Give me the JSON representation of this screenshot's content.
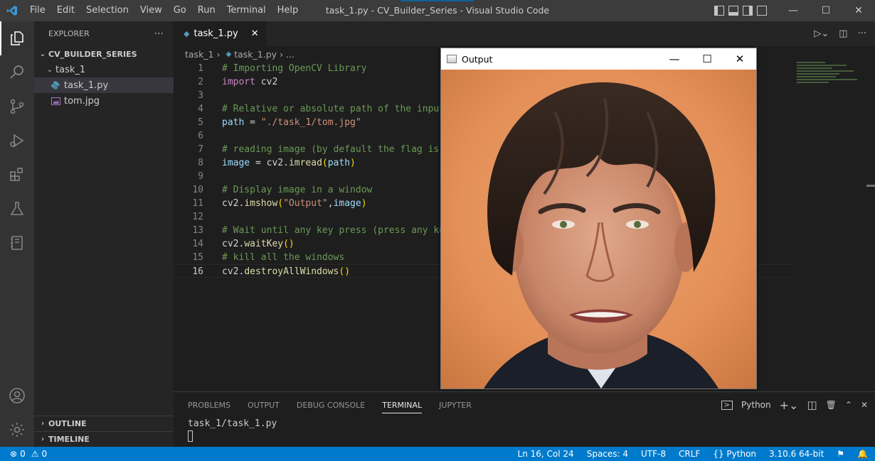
{
  "window": {
    "title": "task_1.py - CV_Builder_Series - Visual Studio Code",
    "menu": [
      "File",
      "Edit",
      "Selection",
      "View",
      "Go",
      "Run",
      "Terminal",
      "Help"
    ],
    "controls": {
      "minimize": "—",
      "maximize": "☐",
      "close": "✕"
    }
  },
  "sidebar": {
    "header": "EXPLORER",
    "more": "···",
    "root": "CV_BUILDER_SERIES",
    "folder": "task_1",
    "files": [
      {
        "name": "task_1.py",
        "icon": "python-icon"
      },
      {
        "name": "tom.jpg",
        "icon": "image-icon"
      }
    ],
    "outline": "OUTLINE",
    "timeline": "TIMELINE"
  },
  "editor": {
    "tab": "task_1.py",
    "breadcrumb": {
      "folder": "task_1",
      "file": "task_1.py",
      "more": "..."
    },
    "lines": [
      {
        "n": "1",
        "parts": [
          {
            "t": "# Importing OpenCV Library",
            "c": "c-com"
          }
        ]
      },
      {
        "n": "2",
        "parts": [
          {
            "t": "import",
            "c": "c-kw"
          },
          {
            "t": " cv2",
            "c": "c-id"
          }
        ]
      },
      {
        "n": "3",
        "parts": []
      },
      {
        "n": "4",
        "parts": [
          {
            "t": "# Relative or absolute path of the input",
            "c": "c-com"
          }
        ]
      },
      {
        "n": "5",
        "parts": [
          {
            "t": "path",
            "c": "c-var"
          },
          {
            "t": " = ",
            "c": "c-id"
          },
          {
            "t": "\"./task_1/tom.jpg\"",
            "c": "c-str"
          }
        ]
      },
      {
        "n": "6",
        "parts": []
      },
      {
        "n": "7",
        "parts": [
          {
            "t": "# reading image (by default the flag is",
            "c": "c-com"
          }
        ]
      },
      {
        "n": "8",
        "parts": [
          {
            "t": "image",
            "c": "c-var"
          },
          {
            "t": " = cv2.",
            "c": "c-id"
          },
          {
            "t": "imread",
            "c": "c-fn"
          },
          {
            "t": "(",
            "c": "c-par"
          },
          {
            "t": "path",
            "c": "c-var"
          },
          {
            "t": ")",
            "c": "c-par"
          }
        ]
      },
      {
        "n": "9",
        "parts": []
      },
      {
        "n": "10",
        "parts": [
          {
            "t": "# Display image in a window",
            "c": "c-com"
          }
        ]
      },
      {
        "n": "11",
        "parts": [
          {
            "t": "cv2.",
            "c": "c-id"
          },
          {
            "t": "imshow",
            "c": "c-fn"
          },
          {
            "t": "(",
            "c": "c-par"
          },
          {
            "t": "\"Output\"",
            "c": "c-str"
          },
          {
            "t": ",",
            "c": "c-id"
          },
          {
            "t": "image",
            "c": "c-var"
          },
          {
            "t": ")",
            "c": "c-par"
          }
        ]
      },
      {
        "n": "12",
        "parts": []
      },
      {
        "n": "13",
        "parts": [
          {
            "t": "# Wait until any key press (press any ke",
            "c": "c-com"
          }
        ]
      },
      {
        "n": "14",
        "parts": [
          {
            "t": "cv2.",
            "c": "c-id"
          },
          {
            "t": "waitKey",
            "c": "c-fn"
          },
          {
            "t": "()",
            "c": "c-par"
          }
        ]
      },
      {
        "n": "15",
        "parts": [
          {
            "t": "# kill all the windows",
            "c": "c-com"
          }
        ]
      },
      {
        "n": "16",
        "parts": [
          {
            "t": "cv2.",
            "c": "c-id"
          },
          {
            "t": "destroyAllWindows",
            "c": "c-fn"
          },
          {
            "t": "()",
            "c": "c-par"
          }
        ]
      }
    ],
    "current_line": "16"
  },
  "output_window": {
    "title": "Output",
    "controls": {
      "minimize": "—",
      "maximize": "☐",
      "close": "✕"
    }
  },
  "panel": {
    "tabs": [
      "PROBLEMS",
      "OUTPUT",
      "DEBUG CONSOLE",
      "TERMINAL",
      "JUPYTER"
    ],
    "active_tab": "TERMINAL",
    "terminal_profile": "Python",
    "terminal_lines": [
      "task_1/task_1.py"
    ]
  },
  "status": {
    "errors": "0",
    "warnings": "0",
    "position": "Ln 16, Col 24",
    "spaces": "Spaces: 4",
    "encoding": "UTF-8",
    "eol": "CRLF",
    "language": "Python",
    "interpreter": "3.10.6 64-bit"
  },
  "colors": {
    "accent": "#007acc",
    "titlebar": "#3c3c3c",
    "activitybar": "#333333",
    "sidebar": "#252526",
    "editor": "#1e1e1e"
  }
}
